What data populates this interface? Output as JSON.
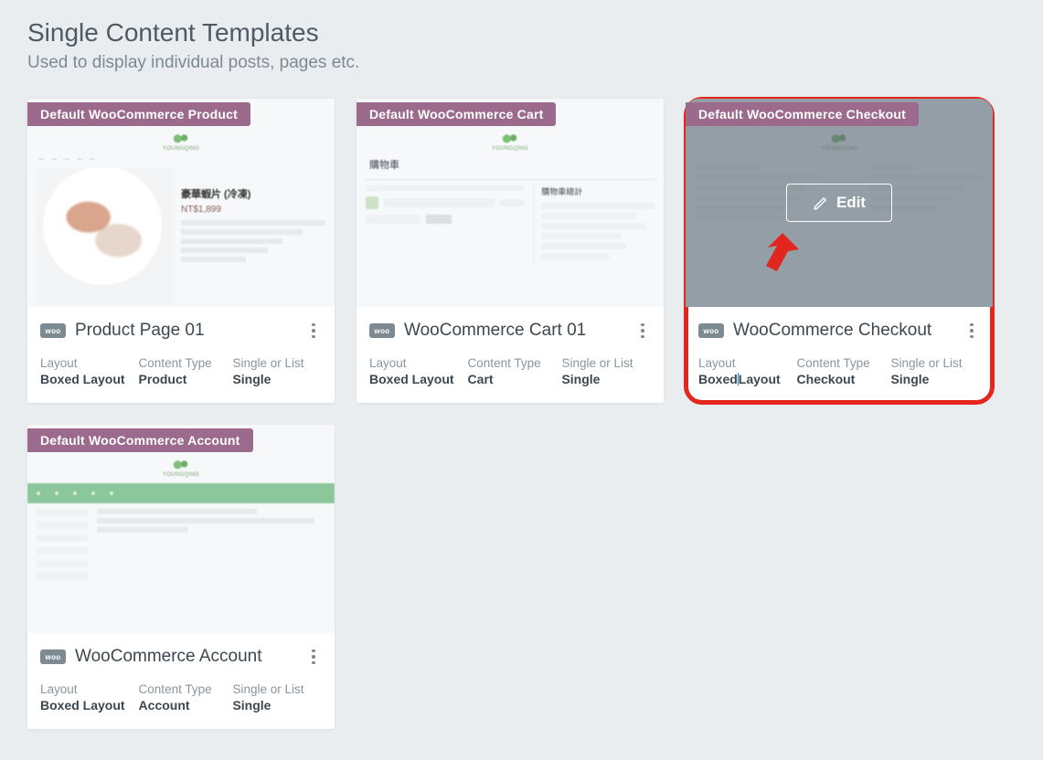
{
  "heading": "Single Content Templates",
  "subheading": "Used to display individual posts, pages etc.",
  "meta_labels": {
    "layout": "Layout",
    "content_type": "Content Type",
    "single_or_list": "Single or List"
  },
  "edit_label": "Edit",
  "woo_badge_text": "woo",
  "cards": [
    {
      "badge": "Default WooCommerce Product",
      "title": "Product Page 01",
      "layout": "Boxed Layout",
      "content_type": "Product",
      "single_or_list": "Single",
      "thumb": {
        "brand": "YOUNGQING",
        "product_title": "豪華蝦片 (冷凍)",
        "product_price": "NT$1,899"
      }
    },
    {
      "badge": "Default WooCommerce Cart",
      "title": "WooCommerce Cart 01",
      "layout": "Boxed Layout",
      "content_type": "Cart",
      "single_or_list": "Single",
      "thumb": {
        "brand": "YOUNGQING",
        "cart_heading": "購物車",
        "totals_heading": "購物車總計"
      }
    },
    {
      "badge": "Default WooCommerce Checkout",
      "title": "WooCommerce Checkout",
      "layout_pre": "Boxed",
      "layout_post": "Layout",
      "content_type": "Checkout",
      "single_or_list": "Single",
      "thumb": {
        "brand": "YOUNGQING"
      }
    },
    {
      "badge": "Default WooCommerce Account",
      "title": "WooCommerce Account",
      "layout": "Boxed Layout",
      "content_type": "Account",
      "single_or_list": "Single",
      "thumb": {
        "brand": "YOUNGQING"
      }
    }
  ]
}
